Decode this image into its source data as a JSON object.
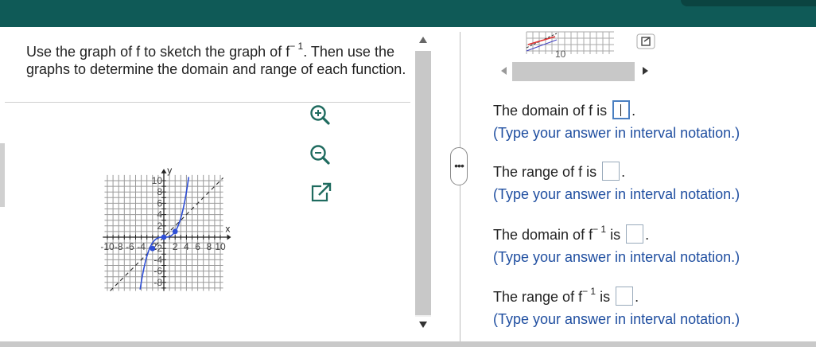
{
  "header": {
    "color": "#0f5a57"
  },
  "question": {
    "part1": "Use the graph of f to sketch the graph of f",
    "sup1": "− 1",
    "part2": ". Then use the graphs to determine the domain and range of each function."
  },
  "graph": {
    "x_axis_label": "x",
    "y_axis_label": "y",
    "x_tick_labels": [
      "-10",
      "-8",
      "-6",
      "-4",
      "-2",
      "2",
      "4",
      "6",
      "8",
      "10"
    ],
    "y_tick_labels": [
      "10",
      "8",
      "6",
      "4",
      "2",
      "-2",
      "-4",
      "-6",
      "-8"
    ],
    "curve_color": "#2f4fd6",
    "points": [
      [
        -2,
        -2
      ],
      [
        0,
        0
      ],
      [
        2,
        1
      ]
    ]
  },
  "tools": {
    "zoom_in": "zoom-in-icon",
    "zoom_out": "zoom-out-icon",
    "popout": "popout-icon"
  },
  "thumbnail": {
    "label": "10"
  },
  "panel_divider": {
    "label": "•••"
  },
  "answers": {
    "domain_f": {
      "prefix": "The domain of f is",
      "suffix": ".",
      "hint": "(Type your answer in interval notation.)"
    },
    "range_f": {
      "prefix": "The range of f is",
      "suffix": ".",
      "hint": "(Type your answer in interval notation.)"
    },
    "domain_finv": {
      "prefix": "The domain of f",
      "sup": "− 1",
      "mid": " is",
      "suffix": ".",
      "hint": "(Type your answer in interval notation.)"
    },
    "range_finv": {
      "prefix": "The range of f",
      "sup": "− 1",
      "mid": " is",
      "suffix": ".",
      "hint": "(Type your answer in interval notation.)"
    }
  }
}
